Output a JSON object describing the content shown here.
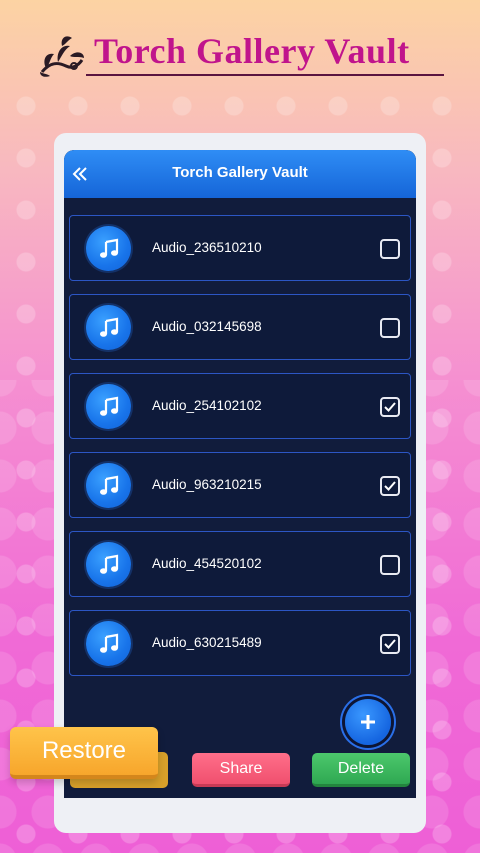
{
  "promo": {
    "title": "Torch Gallery Vault"
  },
  "app_bar": {
    "title": "Torch Gallery Vault",
    "back_icon": "double-chevron-left-icon"
  },
  "files": [
    {
      "name": "Audio_236510210",
      "checked": false
    },
    {
      "name": "Audio_032145698",
      "checked": false
    },
    {
      "name": "Audio_254102102",
      "checked": true
    },
    {
      "name": "Audio_963210215",
      "checked": true
    },
    {
      "name": "Audio_454520102",
      "checked": false
    },
    {
      "name": "Audio_630215489",
      "checked": true
    }
  ],
  "actions": {
    "restore_label": "Restore",
    "share_label": "Share",
    "delete_label": "Delete",
    "fab_icon": "plus-icon"
  },
  "colors": {
    "accent_blue": "#1565d8",
    "title_magenta": "#c0148c",
    "share_red": "#f0506e",
    "delete_green": "#2fa852",
    "restore_orange": "#f7a62c"
  }
}
